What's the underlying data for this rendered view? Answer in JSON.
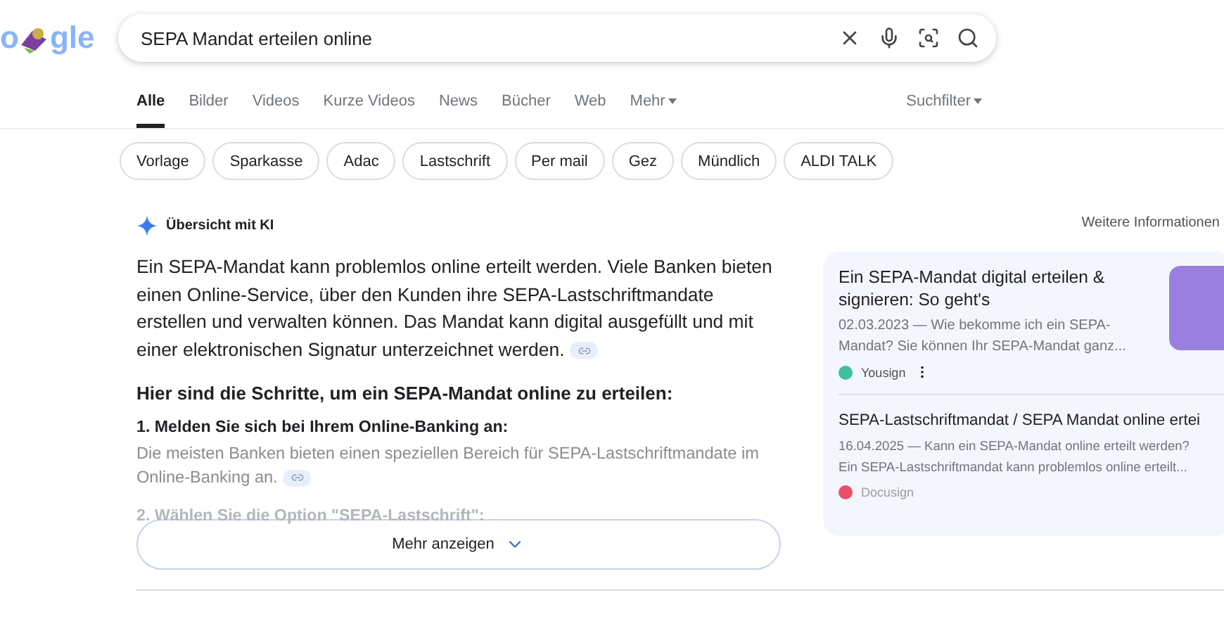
{
  "logo": {
    "text_before": "o",
    "text_after": "gle"
  },
  "search": {
    "value": "SEPA Mandat erteilen online"
  },
  "tabs": [
    {
      "label": "Alle",
      "selected": true
    },
    {
      "label": "Bilder",
      "selected": false
    },
    {
      "label": "Videos",
      "selected": false
    },
    {
      "label": "Kurze Videos",
      "selected": false
    },
    {
      "label": "News",
      "selected": false
    },
    {
      "label": "Bücher",
      "selected": false
    },
    {
      "label": "Web",
      "selected": false
    },
    {
      "label": "Mehr",
      "selected": false,
      "dropdown": true
    }
  ],
  "search_filter": "Suchfilter",
  "chips": [
    "Vorlage",
    "Sparkasse",
    "Adac",
    "Lastschrift",
    "Per mail",
    "Gez",
    "Mündlich",
    "ALDI TALK"
  ],
  "ai_overview": {
    "title": "Übersicht mit KI",
    "summary": "Ein SEPA-Mandat kann problemlos online erteilt werden. Viele Banken bieten einen Online-Service, über den Kunden ihre SEPA-Lastschriftmandate erstellen und verwalten können. Das Mandat kann digital ausgefüllt und mit einer elektronischen Signatur unterzeichnet werden.",
    "steps_heading": "Hier sind die Schritte, um ein SEPA-Mandat online zu erteilen:",
    "steps": [
      {
        "title": "1. Melden Sie sich bei Ihrem Online-Banking an:",
        "text": "Die meisten Banken bieten einen speziellen Bereich für SEPA-Lastschriftmandate im Online-Banking an."
      },
      {
        "title": "2. Wählen Sie die Option \"SEPA-Lastschrift\":"
      }
    ],
    "more_button": "Mehr anzeigen"
  },
  "more_info": "Weitere Informationen",
  "sources": [
    {
      "title": "Ein SEPA-Mandat digital erteilen & signieren: So geht's",
      "snippet": [
        "02.03.2023 — Wie bekomme ich ein SEPA-",
        "Mandat? Sie können Ihr SEPA-Mandat ganz..."
      ],
      "site": "Yousign",
      "color": "#3fbf9a",
      "thumbnail": true
    },
    {
      "title": "SEPA-Lastschriftmandat / SEPA Mandat online ertei",
      "snippet": [
        "16.04.2025 — Kann ein SEPA-Mandat online erteilt werden?",
        "Ein SEPA-Lastschriftmandat kann problemlos online erteilt..."
      ],
      "site": "Docusign",
      "color": "#e8506a",
      "thumbnail": false
    }
  ]
}
